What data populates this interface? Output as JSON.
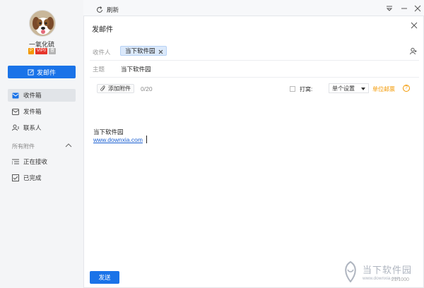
{
  "sidebar": {
    "username": "一氧化硫",
    "badges": {
      "p": "P",
      "vip": "VIP0",
      "level": "普"
    },
    "compose_label": "发邮件",
    "items": [
      {
        "label": "收件箱",
        "icon": "inbox-icon",
        "active": true
      },
      {
        "label": "发件箱",
        "icon": "mail-icon",
        "active": false
      },
      {
        "label": "联系人",
        "icon": "contacts-icon",
        "active": false
      }
    ],
    "attachments_section": "所有附件",
    "attachment_items": [
      {
        "label": "正在接收",
        "icon": "list-icon"
      },
      {
        "label": "已完成",
        "icon": "check-icon"
      }
    ]
  },
  "topbar": {
    "refresh_label": "刷新"
  },
  "dialog": {
    "title": "发邮件",
    "recipient_label": "收件人",
    "recipient_chip": "当下软件园",
    "subject_label": "主题",
    "subject_value": "当下软件园",
    "attach_label": "添加附件",
    "attach_count": "0/20",
    "print_label": "打窝:",
    "print_select": "单个设置",
    "unit_mail": "单位邮票",
    "help": "?",
    "body_line1": "当下软件园",
    "body_link": "www.downxia.com",
    "send_label": "发送",
    "char_count": "21/1000"
  },
  "watermark": {
    "cn": "当下软件园",
    "en": "www.downxia.com"
  },
  "colors": {
    "accent": "#1a73e8",
    "orange": "#f39800",
    "link": "#1a5fd1"
  }
}
